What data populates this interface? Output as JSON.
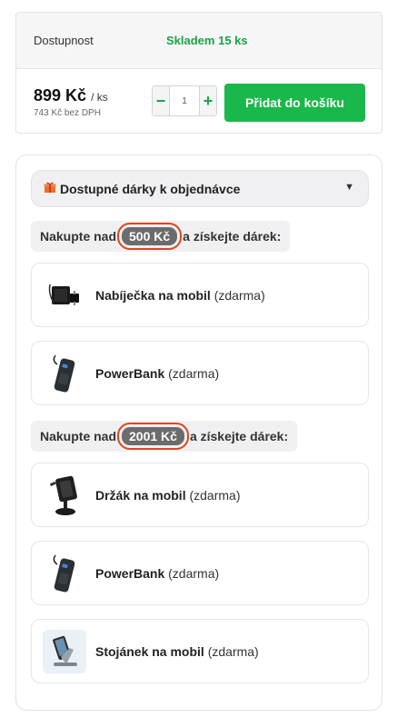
{
  "availability": {
    "label": "Dostupnost",
    "value": "Skladem 15 ks"
  },
  "price": {
    "main": "899 Kč",
    "unit": "/ ks",
    "without_vat": "743 Kč bez DPH"
  },
  "quantity": {
    "minus": "−",
    "value": "1",
    "plus": "+"
  },
  "add_to_cart": "Přidat do košíku",
  "gifts": {
    "title": "Dostupné dárky k objednávce",
    "gift_icon": "gift-icon",
    "caret": "▼",
    "tiers": [
      {
        "prefix": "Nakupte nad",
        "amount": "500 Kč",
        "suffix": "a získejte dárek:",
        "items": [
          {
            "name": "Nabíječka na mobil",
            "note": "(zdarma)",
            "icon": "charger-icon"
          },
          {
            "name": "PowerBank",
            "note": "(zdarma)",
            "icon": "powerbank-icon"
          }
        ]
      },
      {
        "prefix": "Nakupte nad",
        "amount": "2001 Kč",
        "suffix": "a získejte dárek:",
        "items": [
          {
            "name": "Držák na mobil",
            "note": "(zdarma)",
            "icon": "phone-holder-icon"
          },
          {
            "name": "PowerBank",
            "note": "(zdarma)",
            "icon": "powerbank-icon"
          },
          {
            "name": "Stojánek na mobil",
            "note": "(zdarma)",
            "icon": "phone-stand-icon"
          }
        ]
      }
    ]
  },
  "colors": {
    "accent_green": "#19b84a",
    "stock_green": "#1aa34a",
    "highlight_red": "#e0441f",
    "amount_pill": "#6b6b6b"
  }
}
